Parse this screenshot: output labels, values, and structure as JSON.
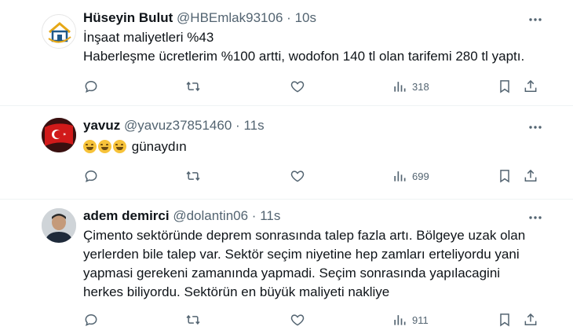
{
  "tweets": [
    {
      "name": "Hüseyin Bulut",
      "handle": "@HBEmlak93106",
      "separator": "·",
      "time": "10s",
      "lines": [
        "İnşaat maliyetleri %43",
        "Haberleşme ücretlerim %100 artti, wodofon 140 tl olan tarifemi 280 tl yaptı."
      ],
      "views": "318",
      "avatar_icon": "house-logo-icon"
    },
    {
      "name": "yavuz",
      "handle": "@yavuz37851460",
      "separator": "·",
      "time": "11s",
      "emoji_count": 3,
      "text": "günaydın",
      "views": "699",
      "avatar_icon": "flag-avatar-icon"
    },
    {
      "name": "adem demirci",
      "handle": "@dolantin06",
      "separator": "·",
      "time": "11s",
      "lines": [
        "Çimento sektöründe deprem sonrasında talep fazla artı. Bölgeye uzak olan",
        "yerlerden bile talep var. Sektör seçim niyetine hep zamları erteliyordu yani",
        "yapmasi gerekeni zamanında yapmadi. Seçim sonrasında yapılacagini",
        "herkes biliyordu. Sektörün en büyük maliyeti nakliye"
      ],
      "views": "911",
      "avatar_icon": "person-photo-icon"
    }
  ],
  "colors": {
    "text": "#0f1419",
    "secondary": "#536471",
    "divider": "#eff3f4"
  }
}
